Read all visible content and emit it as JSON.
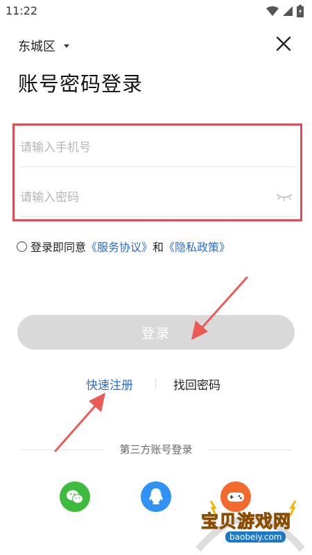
{
  "status_bar": {
    "time": "11:22"
  },
  "header": {
    "location": "东城区",
    "title": "账号密码登录"
  },
  "form": {
    "phone_placeholder": "请输入手机号",
    "password_placeholder": "请输入密码"
  },
  "agreement": {
    "prefix": "登录即同意",
    "service_link": "《服务协议》",
    "conjunction": "和",
    "privacy_link": "《隐私政策》"
  },
  "login_button": "登录",
  "links": {
    "quick_register": "快速注册",
    "find_password": "找回密码"
  },
  "third_party": {
    "label": "第三方账号登录",
    "icons": [
      "wechat-icon",
      "qq-icon",
      "game-controller-icon"
    ]
  },
  "watermark": {
    "text": "宝贝游戏网",
    "url": "baobeiy.com"
  },
  "colors": {
    "highlight_box": "#e24a55",
    "link_blue": "#2a6bd6",
    "login_button_disabled": "#d9d9d9",
    "wechat_green": "#3dbb3d",
    "qq_blue": "#2f92f4",
    "annotation_arrow": "#ec5a55"
  }
}
